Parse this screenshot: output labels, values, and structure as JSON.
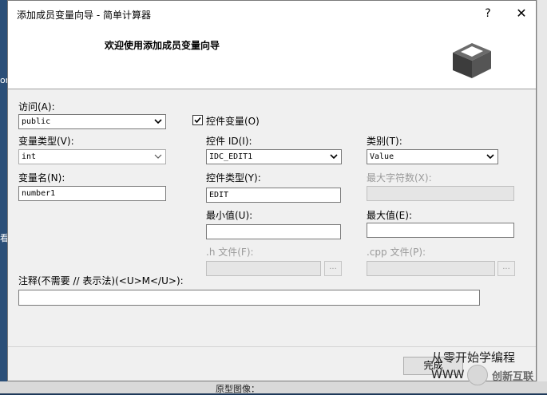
{
  "window": {
    "title": "添加成员变量向导 - 简单计算器",
    "help_glyph": "?",
    "close_glyph": "✕"
  },
  "header": {
    "title": "欢迎使用添加成员变量向导"
  },
  "form": {
    "access": {
      "label": "访问(A):",
      "value": "public"
    },
    "control_variable": {
      "label": "控件变量(O)",
      "checked": true
    },
    "var_type": {
      "label": "变量类型(V):",
      "value": "int"
    },
    "control_id": {
      "label": "控件 ID(I):",
      "value": "IDC_EDIT1"
    },
    "category": {
      "label": "类别(T):",
      "value": "Value"
    },
    "var_name": {
      "label": "变量名(N):",
      "value": "number1"
    },
    "control_type": {
      "label": "控件类型(Y):",
      "value": "EDIT"
    },
    "max_chars": {
      "label": "最大字符数(X):",
      "value": ""
    },
    "min_value": {
      "label": "最小值(U):",
      "value": ""
    },
    "max_value": {
      "label": "最大值(E):",
      "value": ""
    },
    "h_file": {
      "label": ".h 文件(F):",
      "value": "",
      "browse": "..."
    },
    "cpp_file": {
      "label": ".cpp 文件(P):",
      "value": "",
      "browse": "..."
    },
    "comment": {
      "label": "注释(不需要 // 表示法)(<U>M</U>):",
      "value": ""
    }
  },
  "buttons": {
    "finish": "完成"
  },
  "background": {
    "bottom_label": "原型图像：",
    "side_chars": [
      "on",
      "看"
    ]
  },
  "watermark": {
    "line1": "从零开始学编程",
    "line2": "WWW",
    "brand": "创新互联"
  }
}
